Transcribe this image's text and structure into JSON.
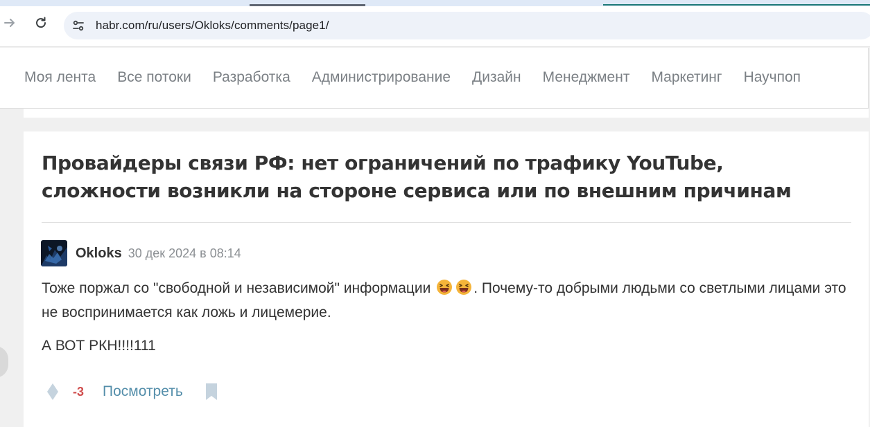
{
  "browser": {
    "url": "habr.com/ru/users/Okloks/comments/page1/",
    "icons": {
      "forward": "arrow-right-icon",
      "reload": "reload-icon",
      "site_info": "tune-icon"
    }
  },
  "nav": {
    "items": [
      {
        "label": "Моя лента"
      },
      {
        "label": "Все потоки"
      },
      {
        "label": "Разработка"
      },
      {
        "label": "Администрирование"
      },
      {
        "label": "Дизайн"
      },
      {
        "label": "Менеджмент"
      },
      {
        "label": "Маркетинг"
      },
      {
        "label": "Научпоп"
      }
    ]
  },
  "comment": {
    "post_title": "Провайдеры связи РФ: нет ограничений по трафику YouTube, сложности возникли на стороне сервиса или по внешним причинам",
    "author": "Okloks",
    "datetime": "30 дек 2024 в 08:14",
    "text_before_emoji": "Тоже поржал со \"свободной и независимой\" информации ",
    "text_after_emoji": ". Почему-то добрыми людьми со светлыми лицами это не воспринимается как ложь и лицемерие.",
    "text_p2": "А ВОТ РКН!!!!111",
    "emoji": "laughing-face-emoji",
    "score": "-3",
    "view_label": "Посмотреть"
  },
  "colors": {
    "score_negative": "#d04e4e",
    "link": "#548eaa",
    "nav_text": "#7b8085"
  }
}
